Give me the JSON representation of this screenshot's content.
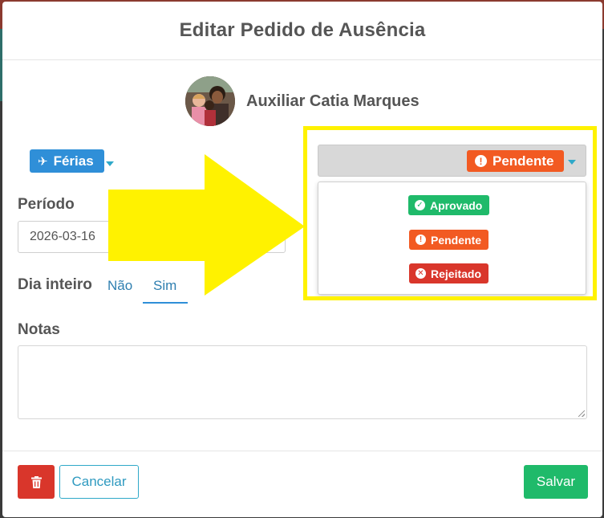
{
  "dialog": {
    "title": "Editar Pedido de Ausência"
  },
  "employee": {
    "name": "Auxiliar Catia Marques"
  },
  "absence_type": {
    "label": "Férias",
    "icon": "airplane-icon"
  },
  "status": {
    "selected": "Pendente",
    "options": [
      {
        "label": "Aprovado",
        "color": "#1fba6a",
        "icon": "check-circle-icon"
      },
      {
        "label": "Pendente",
        "color": "#f25a22",
        "icon": "exclamation-circle-icon"
      },
      {
        "label": "Rejeitado",
        "color": "#d9362b",
        "icon": "x-circle-icon"
      }
    ]
  },
  "period": {
    "label": "Período",
    "start": "2026-03-16"
  },
  "all_day": {
    "label": "Dia inteiro",
    "no": "Não",
    "yes": "Sim",
    "selected": "Sim"
  },
  "notes": {
    "label": "Notas",
    "value": ""
  },
  "footer": {
    "cancel": "Cancelar",
    "save": "Salvar"
  },
  "annotation": {
    "highlight_color": "#fff200"
  }
}
